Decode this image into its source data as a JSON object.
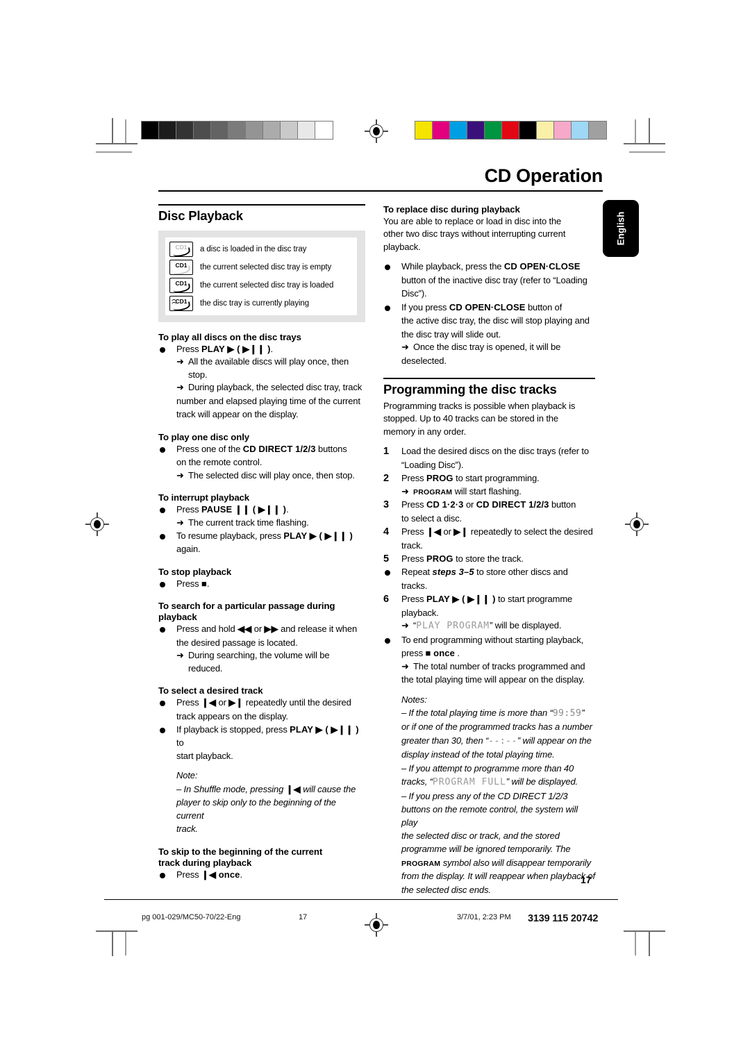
{
  "header": {
    "title": "CD Operation",
    "language_tab": "English"
  },
  "calibration": {
    "grayscale": [
      "#000000",
      "#1c1c1c",
      "#333333",
      "#4d4d4d",
      "#636363",
      "#7b7b7b",
      "#949494",
      "#ababab",
      "#c9c9c9",
      "#e8e8e8",
      "#ffffff"
    ],
    "colors": [
      "#f5e400",
      "#e2007f",
      "#009fe3",
      "#3b0f7a",
      "#009540",
      "#e30613",
      "#000000",
      "#fbf0a8",
      "#f6a9c8",
      "#9ed8f5",
      "#a0a0a0"
    ]
  },
  "left_column": {
    "section_title": "Disc Playback",
    "disc_legend": [
      {
        "icon": "disc-loaded-icon",
        "label": "CD1",
        "label_faint": true,
        "swoosh_faint": false,
        "text": "a disc is loaded in the disc tray"
      },
      {
        "icon": "disc-tray-empty-icon",
        "label": "CD1",
        "label_faint": false,
        "swoosh_faint": true,
        "text": "the current selected disc tray is empty"
      },
      {
        "icon": "disc-tray-loaded-icon",
        "label": "CD1",
        "label_faint": false,
        "swoosh_faint": false,
        "text": "the current selected disc tray is loaded"
      },
      {
        "icon": "disc-tray-playing-icon",
        "label": "CD1",
        "label_faint": false,
        "swoosh_faint": false,
        "text": "the disc tray is currently playing"
      }
    ],
    "s1": {
      "heading": "To play all discs on the disc trays",
      "b1_pre": "Press ",
      "b1_bold": "PLAY",
      "b1_sym": " ▶ ( ▶❙❙ )",
      "b1_post": ".",
      "a1": "All the available discs will play once, then stop.",
      "a2": "During playback, the selected disc tray, track",
      "a2b": "number and elapsed playing time of the current",
      "a2c": "track will appear on the display."
    },
    "s2": {
      "heading": "To play one disc only",
      "b1_pre": "Press one of the ",
      "b1_bold": "CD DIRECT 1/2/3",
      "b1_post": " buttons",
      "b1_line2": "on the remote control.",
      "a1": "The selected disc will play once, then stop."
    },
    "s3": {
      "heading": "To interrupt playback",
      "b1_pre": "Press ",
      "b1_bold": "PAUSE",
      "b1_sym": " ❙❙ ( ▶❙❙ )",
      "b1_post": ".",
      "a1": "The current track time flashing.",
      "b2_pre": "To resume playback, press ",
      "b2_bold": "PLAY",
      "b2_sym": " ▶ ( ▶❙❙ )",
      "b2_line2": "again."
    },
    "s4": {
      "heading": "To stop playback",
      "b1_pre": "Press ",
      "b1_sym": "■",
      "b1_post": "."
    },
    "s5": {
      "heading": "To search for a particular passage during",
      "heading2": "playback",
      "b1_pre": "Press and hold ",
      "b1_sym1": "◀◀",
      "b1_mid": " or ",
      "b1_sym2": "▶▶",
      "b1_post": " and release it when",
      "b1_line2": "the desired passage is located.",
      "a1": "During searching, the volume will be reduced."
    },
    "s6": {
      "heading": "To select a desired track",
      "b1_pre": "Press ",
      "b1_sym1": "❙◀",
      "b1_mid": " or ",
      "b1_sym2": "▶❙",
      "b1_post": " repeatedly until the desired",
      "b1_line2": "track appears on the display.",
      "b2_pre": "If playback is stopped, press ",
      "b2_bold": "PLAY",
      "b2_sym": " ▶ ( ▶❙❙ )",
      "b2_post": " to",
      "b2_line2": "start playback.",
      "note_label": "Note:",
      "note_l1_a": "–  In Shuffle mode, pressing ",
      "note_l1_sym": "❙◀",
      "note_l1_b": " will cause the",
      "note_l2": "player to skip only to the beginning of the current",
      "note_l3": "track."
    },
    "s7": {
      "heading": "To skip to the beginning of the current",
      "heading2": "track during playback",
      "b1_pre": "Press  ",
      "b1_sym": "❙◀",
      "b1_bold": " once",
      "b1_post": "."
    }
  },
  "right_column": {
    "s1": {
      "heading": "To replace disc during playback",
      "p1": "You are able to replace or load in disc into the",
      "p2": "other two disc trays without interrupting current",
      "p3": "playback.",
      "b1_pre": "While playback, press the ",
      "b1_bold": "CD OPEN·CLOSE",
      "b1_line2": "button of the inactive disc tray (refer to “Loading",
      "b1_line3": "Disc”).",
      "b2_pre": "If you press ",
      "b2_bold": "CD OPEN·CLOSE",
      "b2_post": "  button of",
      "b2_line2": "the active disc tray, the disc will stop playing and",
      "b2_line3": "the disc tray will slide out.",
      "a1": "Once the disc tray is opened, it will be",
      "a1b": "deselected."
    },
    "section_title": "Programming the disc tracks",
    "intro1": "Programming tracks is possible when playback is",
    "intro2": "stopped. Up to 40 tracks can be stored in the",
    "intro3": "memory in any order.",
    "steps": [
      {
        "n": "1",
        "l1": "Load the desired discs on the disc trays (refer to",
        "l2": "“Loading Disc”)."
      },
      {
        "n": "2",
        "pre": "Press ",
        "bold": "PROG",
        "post": " to start programming.",
        "arrow_sc": "PROGRAM",
        "arrow_post": " will start flashing."
      },
      {
        "n": "3",
        "pre": "Press ",
        "bold": "CD 1·2·3",
        "mid": " or ",
        "bold2": "CD DIRECT 1/2/3",
        "post": " button",
        "l2": "to select a disc."
      },
      {
        "n": "4",
        "pre": "Press ",
        "sym1": "❙◀",
        "mid": " or ",
        "sym2": "▶❙",
        "post": " repeatedly to select the desired",
        "l2": "track."
      },
      {
        "n": "5",
        "pre": "Press ",
        "bold": "PROG",
        "post": " to store the track."
      }
    ],
    "repeat_pre": "Repeat ",
    "repeat_bold": "steps 3–5",
    "repeat_post": " to store other discs and",
    "repeat_l2": "tracks.",
    "step6": {
      "n": "6",
      "pre": "Press ",
      "bold": "PLAY",
      "sym": " ▶ ( ▶❙❙ )",
      "post": " to start programme",
      "l2": "playback.",
      "arrow_pre": "“",
      "arrow_lcd": "PLAY PROGRAM",
      "arrow_post": "” will be displayed."
    },
    "end_b_l1": "To end programming without starting playback,",
    "end_b_l2_pre": "press ",
    "end_b_sym": "■",
    "end_b_bold": " once",
    "end_b_post": " .",
    "end_arrow_l1": "The total number of tracks programmed and",
    "end_arrow_l2": "the total playing time will appear on the display.",
    "notes_label": "Notes:",
    "note1_a": "–  If the total playing time is more than “",
    "note1_lcd": "99:59",
    "note1_b": "”",
    "note1_l2": "or if one of the programmed tracks has a number",
    "note1_l3_a": "greater than 30, then “",
    "note1_lcd2": "--:--",
    "note1_l3_b": "” will appear on the",
    "note1_l4": "display instead of the total playing time.",
    "note2_l1": "–  If you attempt to programme more than 40",
    "note2_l2_a": "tracks, “",
    "note2_lcd": "PROGRAM FULL",
    "note2_l2_b": "” will be displayed.",
    "note3_l1": "–  If you press any of the CD DIRECT 1/2/3",
    "note3_l2": "buttons on the remote control, the system will play",
    "note3_l3": "the selected disc or track, and the stored",
    "note3_l4": "programme will be ignored temporarily. The",
    "note3_l5_sc": "PROGRAM",
    "note3_l5": " symbol also will disappear temporarily",
    "note3_l6": "from the display. It will reappear when playback of",
    "note3_l7": "the selected disc ends."
  },
  "footer": {
    "page_number": "17",
    "file": "pg 001-029/MC50-70/22-Eng",
    "sheet": "17",
    "date": "3/7/01, 2:23 PM",
    "code": "3139 115 20742"
  }
}
